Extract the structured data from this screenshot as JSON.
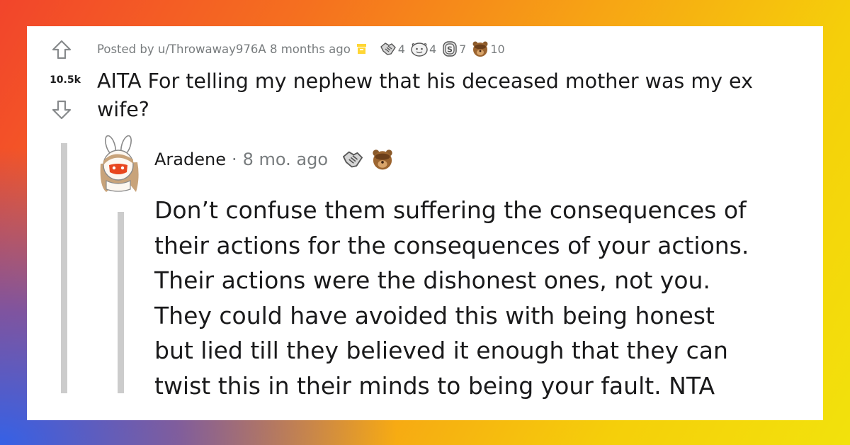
{
  "post": {
    "score": "10.5k",
    "posted_by_prefix": "Posted by",
    "username": "u/Throwaway976A",
    "time_ago": "8 months ago",
    "title": "AITA For telling my nephew that his deceased mother was my ex wife?",
    "awards": [
      {
        "icon": "handshake-award-icon",
        "count": "4"
      },
      {
        "icon": "wholesome-award-icon",
        "count": "4"
      },
      {
        "icon": "silver-coin-award-icon",
        "count": "7"
      },
      {
        "icon": "bear-facepalm-award-icon",
        "count": "10"
      }
    ]
  },
  "comment": {
    "author": "Aradene",
    "separator": "·",
    "time_ago": "8 mo. ago",
    "award_icons": [
      "handshake-award-icon",
      "bear-facepalm-award-icon"
    ],
    "body_lines": [
      "Don’t confuse them suffering the consequences of",
      "their actions for the consequences of your actions.",
      "Their actions were the dishonest ones, not you.",
      "They could have avoided this with being honest",
      "but lied till they believed it enough that they can",
      "twist this in their minds to being your fault. NTA"
    ]
  },
  "colors": {
    "text": "#1a1a1b",
    "meta": "#787c7e",
    "thread_line": "#cccccc",
    "archive": "#ffd635"
  }
}
